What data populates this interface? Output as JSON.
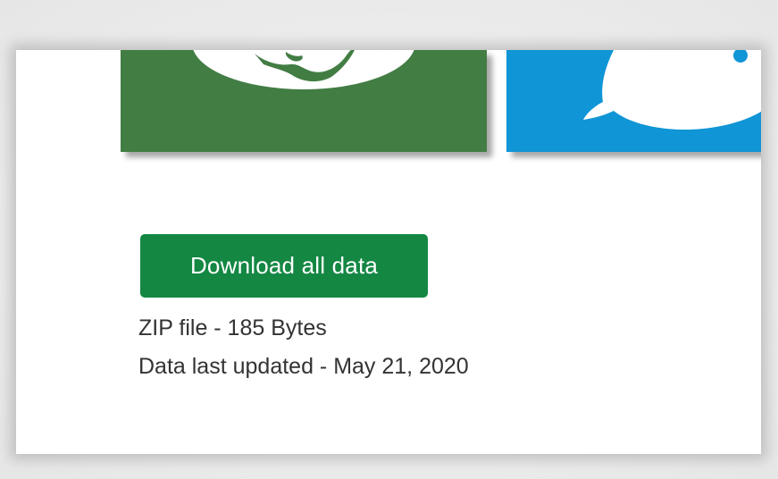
{
  "colors": {
    "green_tile": "#427d44",
    "blue_tile": "#1095d6",
    "button_bg": "#148743",
    "text": "#333333",
    "panel_bg": "#ffffff"
  },
  "tiles": [
    {
      "name": "green-dataset-tile",
      "icon": "globe-icon"
    },
    {
      "name": "blue-dataset-tile",
      "icon": "speech-bubble-icon"
    }
  ],
  "download": {
    "button_label": "Download all data",
    "file_info": "ZIP file - 185 Bytes",
    "last_updated": "Data last updated - May 21, 2020"
  }
}
